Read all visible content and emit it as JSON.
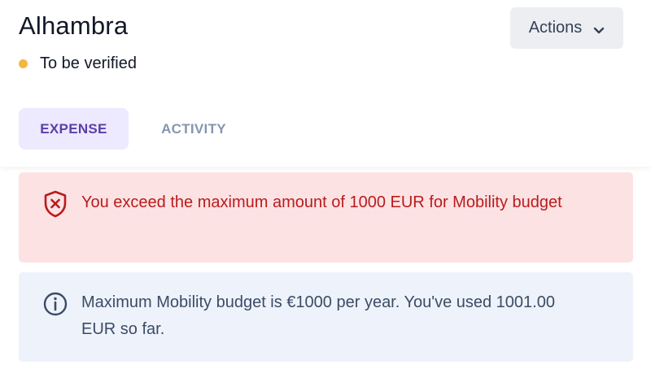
{
  "header": {
    "title": "Alhambra",
    "status": "To be verified",
    "actions_label": "Actions"
  },
  "tabs": [
    {
      "label": "EXPENSE",
      "active": true
    },
    {
      "label": "ACTIVITY",
      "active": false
    }
  ],
  "alerts": {
    "error": {
      "icon": "shield-x-icon",
      "message": "You exceed the maximum amount of 1000 EUR for Mobility budget"
    },
    "info": {
      "icon": "info-circle-icon",
      "message": "Maximum Mobility budget is €1000 per year. You've used 1001.00 EUR so far."
    }
  },
  "colors": {
    "status_dot": "#f4b73f",
    "tab_active_bg": "#ede9fe",
    "tab_active_text": "#5b3ea8",
    "error_bg": "#fde2e4",
    "error_text": "#b91c1c",
    "info_bg": "#eef2fa",
    "info_text": "#3b4c66"
  }
}
